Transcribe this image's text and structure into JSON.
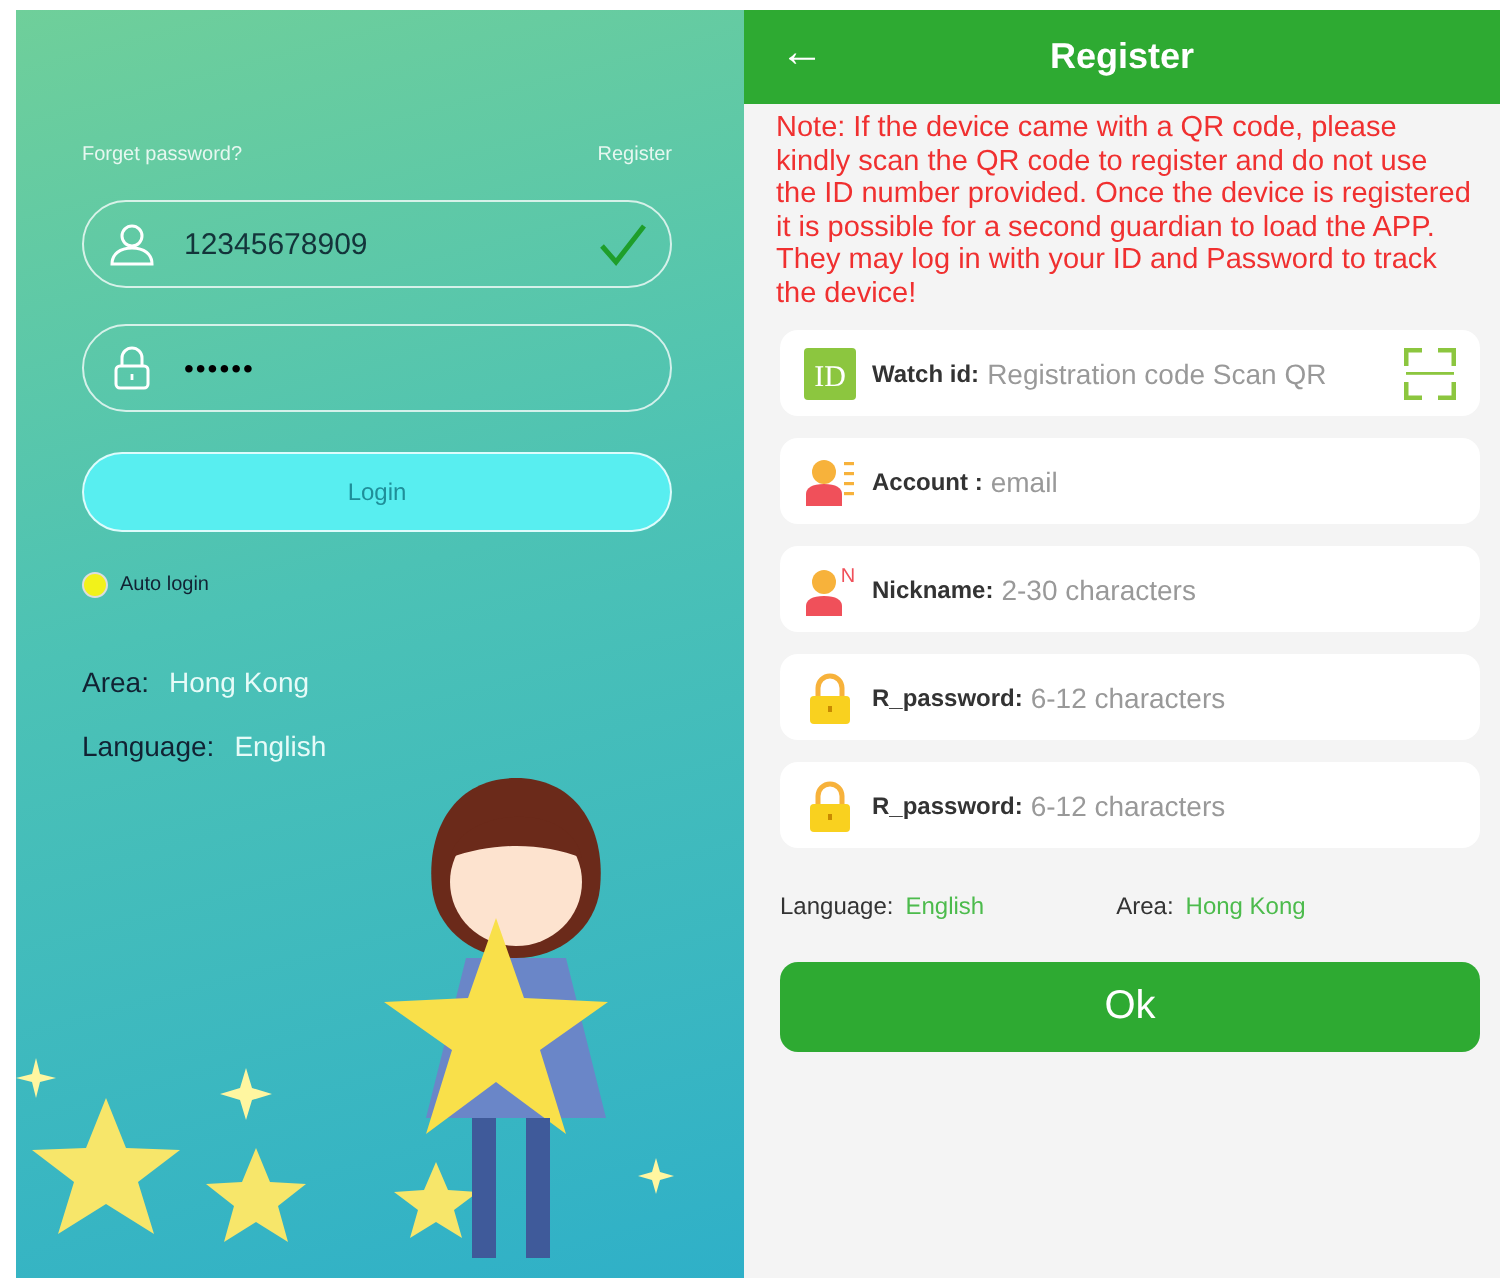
{
  "login": {
    "forget_link": "Forget password?",
    "register_link": "Register",
    "username": {
      "value": "12345678909",
      "valid": true
    },
    "password": {
      "value": "••••••"
    },
    "login_button": "Login",
    "auto_login": {
      "label": "Auto login",
      "checked": true
    },
    "area": {
      "label": "Area:",
      "value": "Hong Kong"
    },
    "language": {
      "label": "Language:",
      "value": "English"
    }
  },
  "register": {
    "title": "Register",
    "back": "←",
    "note": "Note: If the device came with a QR code, please kindly scan the QR code to register and do not use the ID number provided. Once the device is registered it is possible for a second guardian to load the APP. They may log in with your ID and Password to track the  device!",
    "fields": [
      {
        "kind": "id",
        "icon_text": "ID",
        "label": "Watch id:",
        "placeholder": "Registration code Scan QR",
        "scan": true
      },
      {
        "kind": "account",
        "label": "Account :",
        "placeholder": "email"
      },
      {
        "kind": "nickname",
        "icon_text": "N",
        "label": "Nickname:",
        "placeholder": "2-30 characters"
      },
      {
        "kind": "password",
        "label": "R_password:",
        "placeholder": "6-12 characters"
      },
      {
        "kind": "password",
        "label": "R_password:",
        "placeholder": "6-12 characters"
      }
    ],
    "language": {
      "label": "Language:",
      "value": "English"
    },
    "area": {
      "label": "Area:",
      "value": "Hong Kong"
    },
    "ok_button": "Ok"
  }
}
